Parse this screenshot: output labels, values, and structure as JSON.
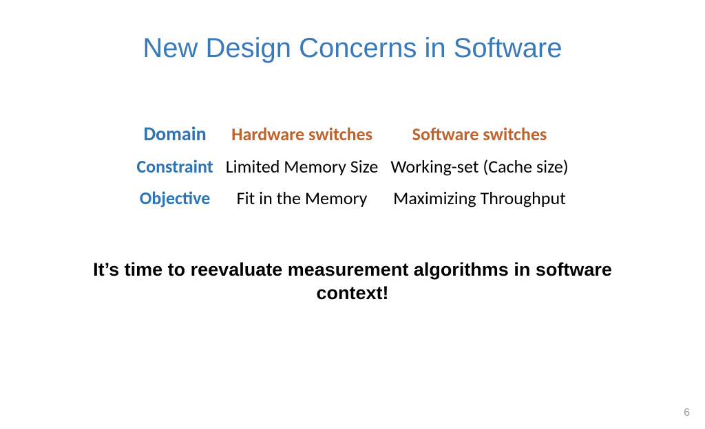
{
  "slide": {
    "title": "New Design Concerns in Software",
    "table": {
      "rowLabels": {
        "domain": "Domain",
        "constraint": "Constraint",
        "objective": "Objective"
      },
      "cols": {
        "hw": {
          "header": "Hardware switches",
          "constraint": "Limited Memory Size",
          "objective": "Fit in the Memory"
        },
        "sw": {
          "header": "Software switches",
          "constraint": "Working-set (Cache size)",
          "objective": "Maximizing Throughput"
        }
      }
    },
    "callout": "It’s time to reevaluate measurement algorithms in software context!",
    "pageNumber": "6"
  }
}
